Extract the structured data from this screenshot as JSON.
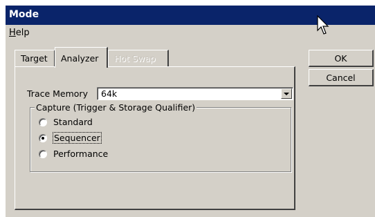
{
  "window": {
    "title": "Mode"
  },
  "menubar": {
    "items": [
      {
        "label": "Help",
        "mnemonic": "H",
        "rest": "elp"
      }
    ]
  },
  "tabs": [
    {
      "label": "Target",
      "state": "inactive"
    },
    {
      "label": "Analyzer",
      "state": "active"
    },
    {
      "label": "Hot Swap",
      "state": "disabled"
    }
  ],
  "analyzer": {
    "trace_memory_label": "Trace Memory",
    "trace_memory_value": "64k",
    "capture_group_label": "Capture (Trigger & Storage Qualifier)",
    "capture_options": [
      {
        "label": "Standard",
        "selected": false
      },
      {
        "label": "Sequencer",
        "selected": true
      },
      {
        "label": "Performance",
        "selected": false
      }
    ]
  },
  "buttons": {
    "ok_label": "OK",
    "cancel_label": "Cancel"
  },
  "icons": {
    "cursor": "mouse-pointer-icon",
    "dropdown": "chevron-down-icon"
  },
  "colors": {
    "titlebar": "#0a246a",
    "face": "#d4d0c8",
    "title_text": "#ffffff"
  }
}
